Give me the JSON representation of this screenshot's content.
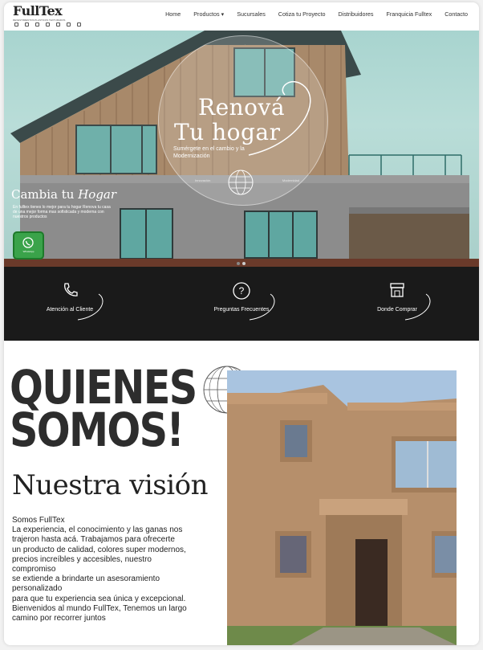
{
  "header": {
    "logo_text": "FullTex",
    "logo_tagline": "REVESTIMIENTOS PLASTICOS TEXTURADOS",
    "nav": [
      "Home",
      "Productos ▾",
      "Sucursales",
      "Cotiza tu Proyecto",
      "Distribuidores",
      "Franquicia Fulltex",
      "Contacto"
    ]
  },
  "hero": {
    "title_line1": "Renová",
    "title_line2": "Tu hogar",
    "subtitle": "Sumérgete en el cambio y la Modernización",
    "tagline_left": "Innovación",
    "tagline_right": "Modernidad",
    "side_title_plain": "Cambia tu ",
    "side_title_italic": "Hogar",
    "side_text": "En fulltex tienes lo mejor para tu hogar Renova tu casa de una mejor forma mas sofisticada y moderna con nuestros productos",
    "whatsapp_label": "WhatsApp",
    "whatsapp_icon": "whatsapp-icon",
    "slides": 2,
    "active_slide": 1
  },
  "features": [
    {
      "label": "Atención al Cliente",
      "icon": "phone-icon"
    },
    {
      "label": "Preguntas Frecuentes",
      "icon": "question-icon"
    },
    {
      "label": "Donde Comprar",
      "icon": "store-icon"
    }
  ],
  "about": {
    "title_line1": "QUIENES",
    "title_line2": "SOMOS!",
    "vision_title": "Nuestra visión",
    "paragraph_lines": [
      "Somos FullTex",
      "La experiencia, el conocimiento y las ganas nos",
      "trajeron hasta acá. Trabajamos para ofrecerte",
      "un producto de calidad, colores super modernos,",
      "precios increíbles y accesibles, nuestro",
      "compromiso",
      "se extiende a brindarte un asesoramiento",
      "personalizado",
      "para que tu experiencia sea única y excepcional.",
      "Bienvenidos al mundo FullTex, Tenemos un largo",
      "camino por recorrer juntos"
    ]
  },
  "colors": {
    "band_bg": "#1a1a1a",
    "whatsapp_green": "#3aa34a",
    "hero_sky": "#a8d4cf",
    "text_dark": "#2d2d2d"
  }
}
